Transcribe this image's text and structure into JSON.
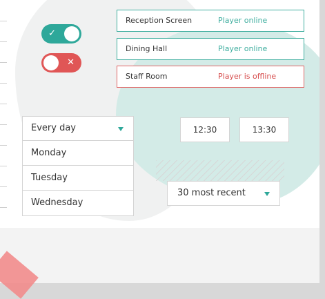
{
  "colors": {
    "teal": "#2ea89a",
    "red": "#e05656",
    "online_border": "#3fae9f",
    "offline_border": "#e06464"
  },
  "toggles": [
    {
      "state": "on",
      "icon": "check-icon",
      "glyph": "✓"
    },
    {
      "state": "off",
      "icon": "close-icon",
      "glyph": "✕"
    }
  ],
  "players": [
    {
      "name": "Reception Screen",
      "status": "Player online"
    },
    {
      "name": "Dining Hall",
      "status": "Player online"
    },
    {
      "name": "Staff Room",
      "status": "Player is offline"
    }
  ],
  "schedule": {
    "frequency": "Every day",
    "days": [
      "Monday",
      "Tuesday",
      "Wednesday"
    ],
    "start_time": "12:30",
    "end_time": "13:30"
  },
  "history": {
    "selected": "30 most recent"
  }
}
